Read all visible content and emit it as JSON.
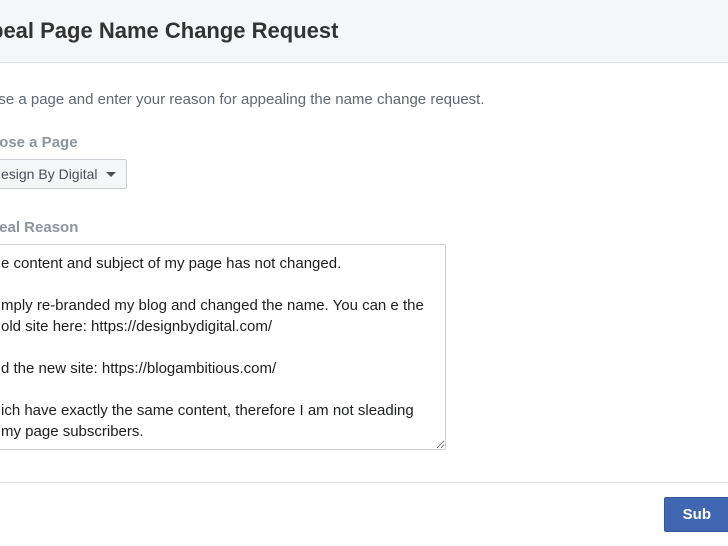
{
  "header": {
    "title": "peal Page Name Change Request"
  },
  "instruction": "ose a page and enter your reason for appealing the name change request.",
  "page_select": {
    "label": "oose a Page",
    "selected": "esign By Digital"
  },
  "appeal": {
    "label": "peal Reason",
    "value": "e content and subject of my page has not changed.\n\nmply re-branded my blog and changed the name. You can e the old site here: https://designbydigital.com/\n\nd the new site: https://blogambitious.com/\n\nich have exactly the same content, therefore I am not sleading my page subscribers."
  },
  "footer": {
    "submit_label": "Sub"
  }
}
